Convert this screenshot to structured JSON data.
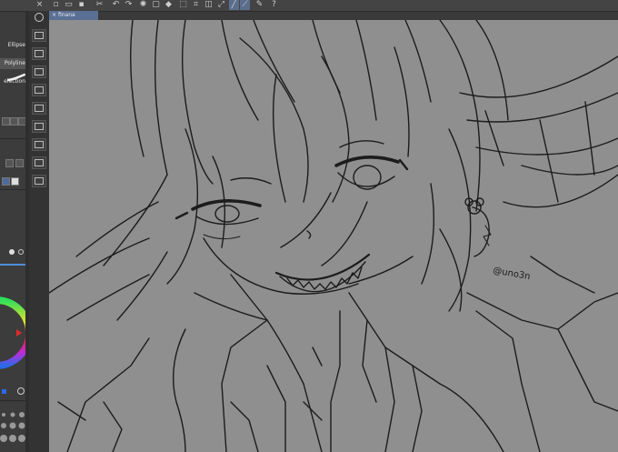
{
  "tools": {
    "ellipse": "Ellipse",
    "polyline": "Polyline",
    "selection": "election"
  },
  "document": {
    "tab_name": "finana",
    "close_glyph": "×"
  },
  "artwork": {
    "signature": "@uno3n"
  },
  "palette": {
    "canvas": "#8f8f8f",
    "ui_dark": "#3c3c3c",
    "tab_active": "#5a6f94",
    "lineart": "#1c1c1c"
  }
}
